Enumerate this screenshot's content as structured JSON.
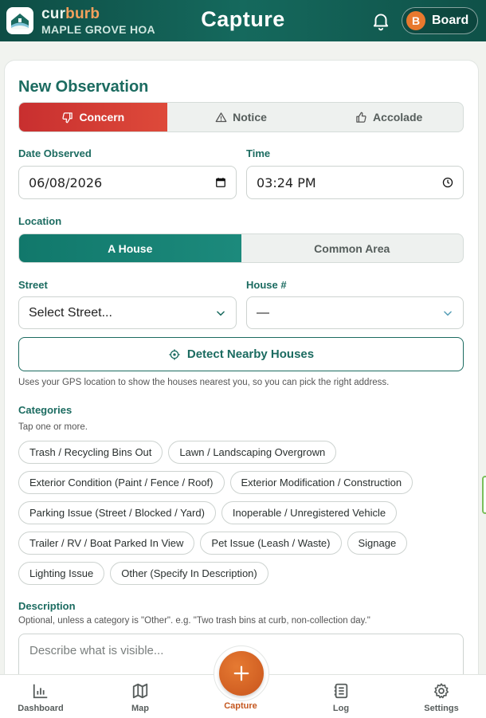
{
  "header": {
    "brand_part1": "cur",
    "brand_part2": "burb",
    "hoa_name": "MAPLE GROVE HOA",
    "title": "Capture",
    "user_initial": "B",
    "user_label": "Board"
  },
  "form": {
    "section_title": "New Observation",
    "types": [
      {
        "label": "Concern",
        "icon": "thumbs-down-icon",
        "active": true
      },
      {
        "label": "Notice",
        "icon": "warning-icon",
        "active": false
      },
      {
        "label": "Accolade",
        "icon": "thumbs-up-icon",
        "active": false
      }
    ],
    "date_label": "Date Observed",
    "date_value": "06/08/2026",
    "time_label": "Time",
    "time_value": "03:24 PM",
    "location_label": "Location",
    "location_options": [
      {
        "label": "A House",
        "active": true
      },
      {
        "label": "Common Area",
        "active": false
      }
    ],
    "street_label": "Street",
    "street_value": "Select Street...",
    "house_label": "House #",
    "house_value": "—",
    "detect_button": "Detect Nearby Houses",
    "detect_help": "Uses your GPS location to show the houses nearest you, so you can pick the right address.",
    "categories_label": "Categories",
    "categories_help": "Tap one or more.",
    "categories": [
      [
        "Trash / Recycling Bins Out",
        "Lawn / Landscaping Overgrown"
      ],
      [
        "Exterior Condition (Paint / Fence / Roof)",
        "Exterior Modification / Construction"
      ],
      [
        "Parking Issue (Street / Blocked / Yard)",
        "Inoperable / Unregistered Vehicle"
      ],
      [
        "Trailer / RV / Boat Parked In View",
        "Pet Issue (Leash / Waste)",
        "Signage"
      ],
      [
        "Lighting Issue",
        "Other (Specify In Description)"
      ]
    ],
    "description_label": "Description",
    "description_help": "Optional, unless a category is \"Other\". e.g. \"Two trash bins at curb, non-collection day.\"",
    "description_placeholder": "Describe what is visible..."
  },
  "nav": {
    "items": [
      {
        "label": "Dashboard",
        "icon": "bar-chart-icon"
      },
      {
        "label": "Map",
        "icon": "map-icon"
      },
      {
        "label": "Capture",
        "icon": "plus-icon",
        "active": true
      },
      {
        "label": "Log",
        "icon": "log-icon"
      },
      {
        "label": "Settings",
        "icon": "gear-icon"
      }
    ]
  },
  "colors": {
    "header": "#15695d",
    "concern": "#d03a34",
    "primary": "#1b6b60",
    "accent": "#e06f2a"
  }
}
